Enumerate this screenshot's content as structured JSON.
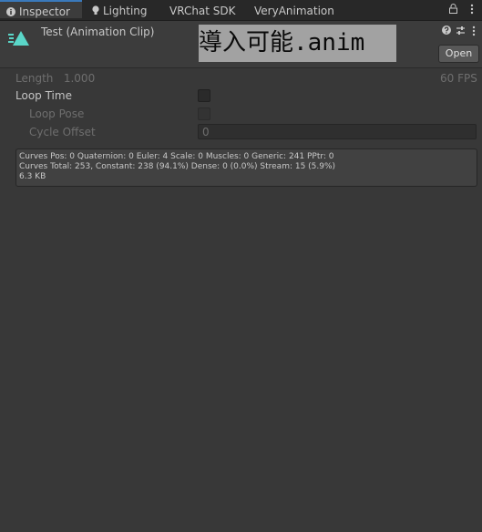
{
  "tabs": [
    {
      "label": "Inspector",
      "icon": "info-icon",
      "active": true
    },
    {
      "label": "Lighting",
      "icon": "lightbulb-icon",
      "active": false
    },
    {
      "label": "VRChat SDK",
      "icon": "",
      "active": false
    },
    {
      "label": "VeryAnimation",
      "icon": "",
      "active": false
    }
  ],
  "tab_icons": {
    "lock": "lock-icon",
    "menu": "kebab-menu-icon"
  },
  "header": {
    "title": "Test (Animation Clip)",
    "overlay_text": "導入可能.anim",
    "open_label": "Open",
    "icons": [
      "help-icon",
      "preset-icon",
      "kebab-menu-icon"
    ],
    "clip_icon": "animation-clip-icon",
    "accent": "#5ad6c8"
  },
  "props": {
    "length_label": "Length",
    "length_value": "1.000",
    "fps": "60 FPS",
    "loop_time_label": "Loop Time",
    "loop_time_checked": false,
    "loop_pose_label": "Loop Pose",
    "loop_pose_checked": false,
    "cycle_offset_label": "Cycle Offset",
    "cycle_offset_value": "0"
  },
  "info": {
    "line1": "Curves Pos: 0 Quaternion: 0 Euler: 4 Scale: 0 Muscles: 0 Generic: 241 PPtr: 0",
    "line2": "Curves Total: 253, Constant: 238 (94.1%) Dense: 0 (0.0%) Stream: 15 (5.9%)",
    "line3": "6.3 KB"
  }
}
